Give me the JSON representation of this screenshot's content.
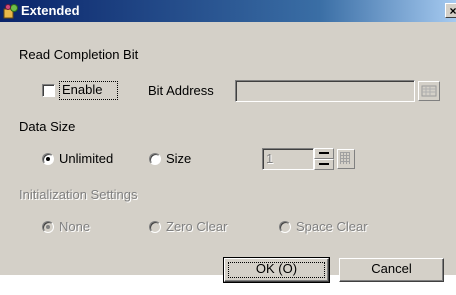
{
  "window": {
    "title": "Extended",
    "close_label": "×"
  },
  "read_completion": {
    "heading": "Read Completion Bit",
    "enable_label": "Enable",
    "enable_checked": false,
    "bit_address_label": "Bit Address",
    "bit_address_value": ""
  },
  "data_size": {
    "heading": "Data Size",
    "unlimited_label": "Unlimited",
    "size_label": "Size",
    "selected": "Unlimited",
    "size_value": "1"
  },
  "init_settings": {
    "heading": "Initialization Settings",
    "none_label": "None",
    "zero_clear_label": "Zero Clear",
    "space_clear_label": "Space Clear",
    "selected": "None"
  },
  "buttons": {
    "ok_label": "OK (O)",
    "cancel_label": "Cancel"
  },
  "icons": {
    "app": "app-icon",
    "keypad": "keypad-icon",
    "spin": "spin-icon"
  }
}
